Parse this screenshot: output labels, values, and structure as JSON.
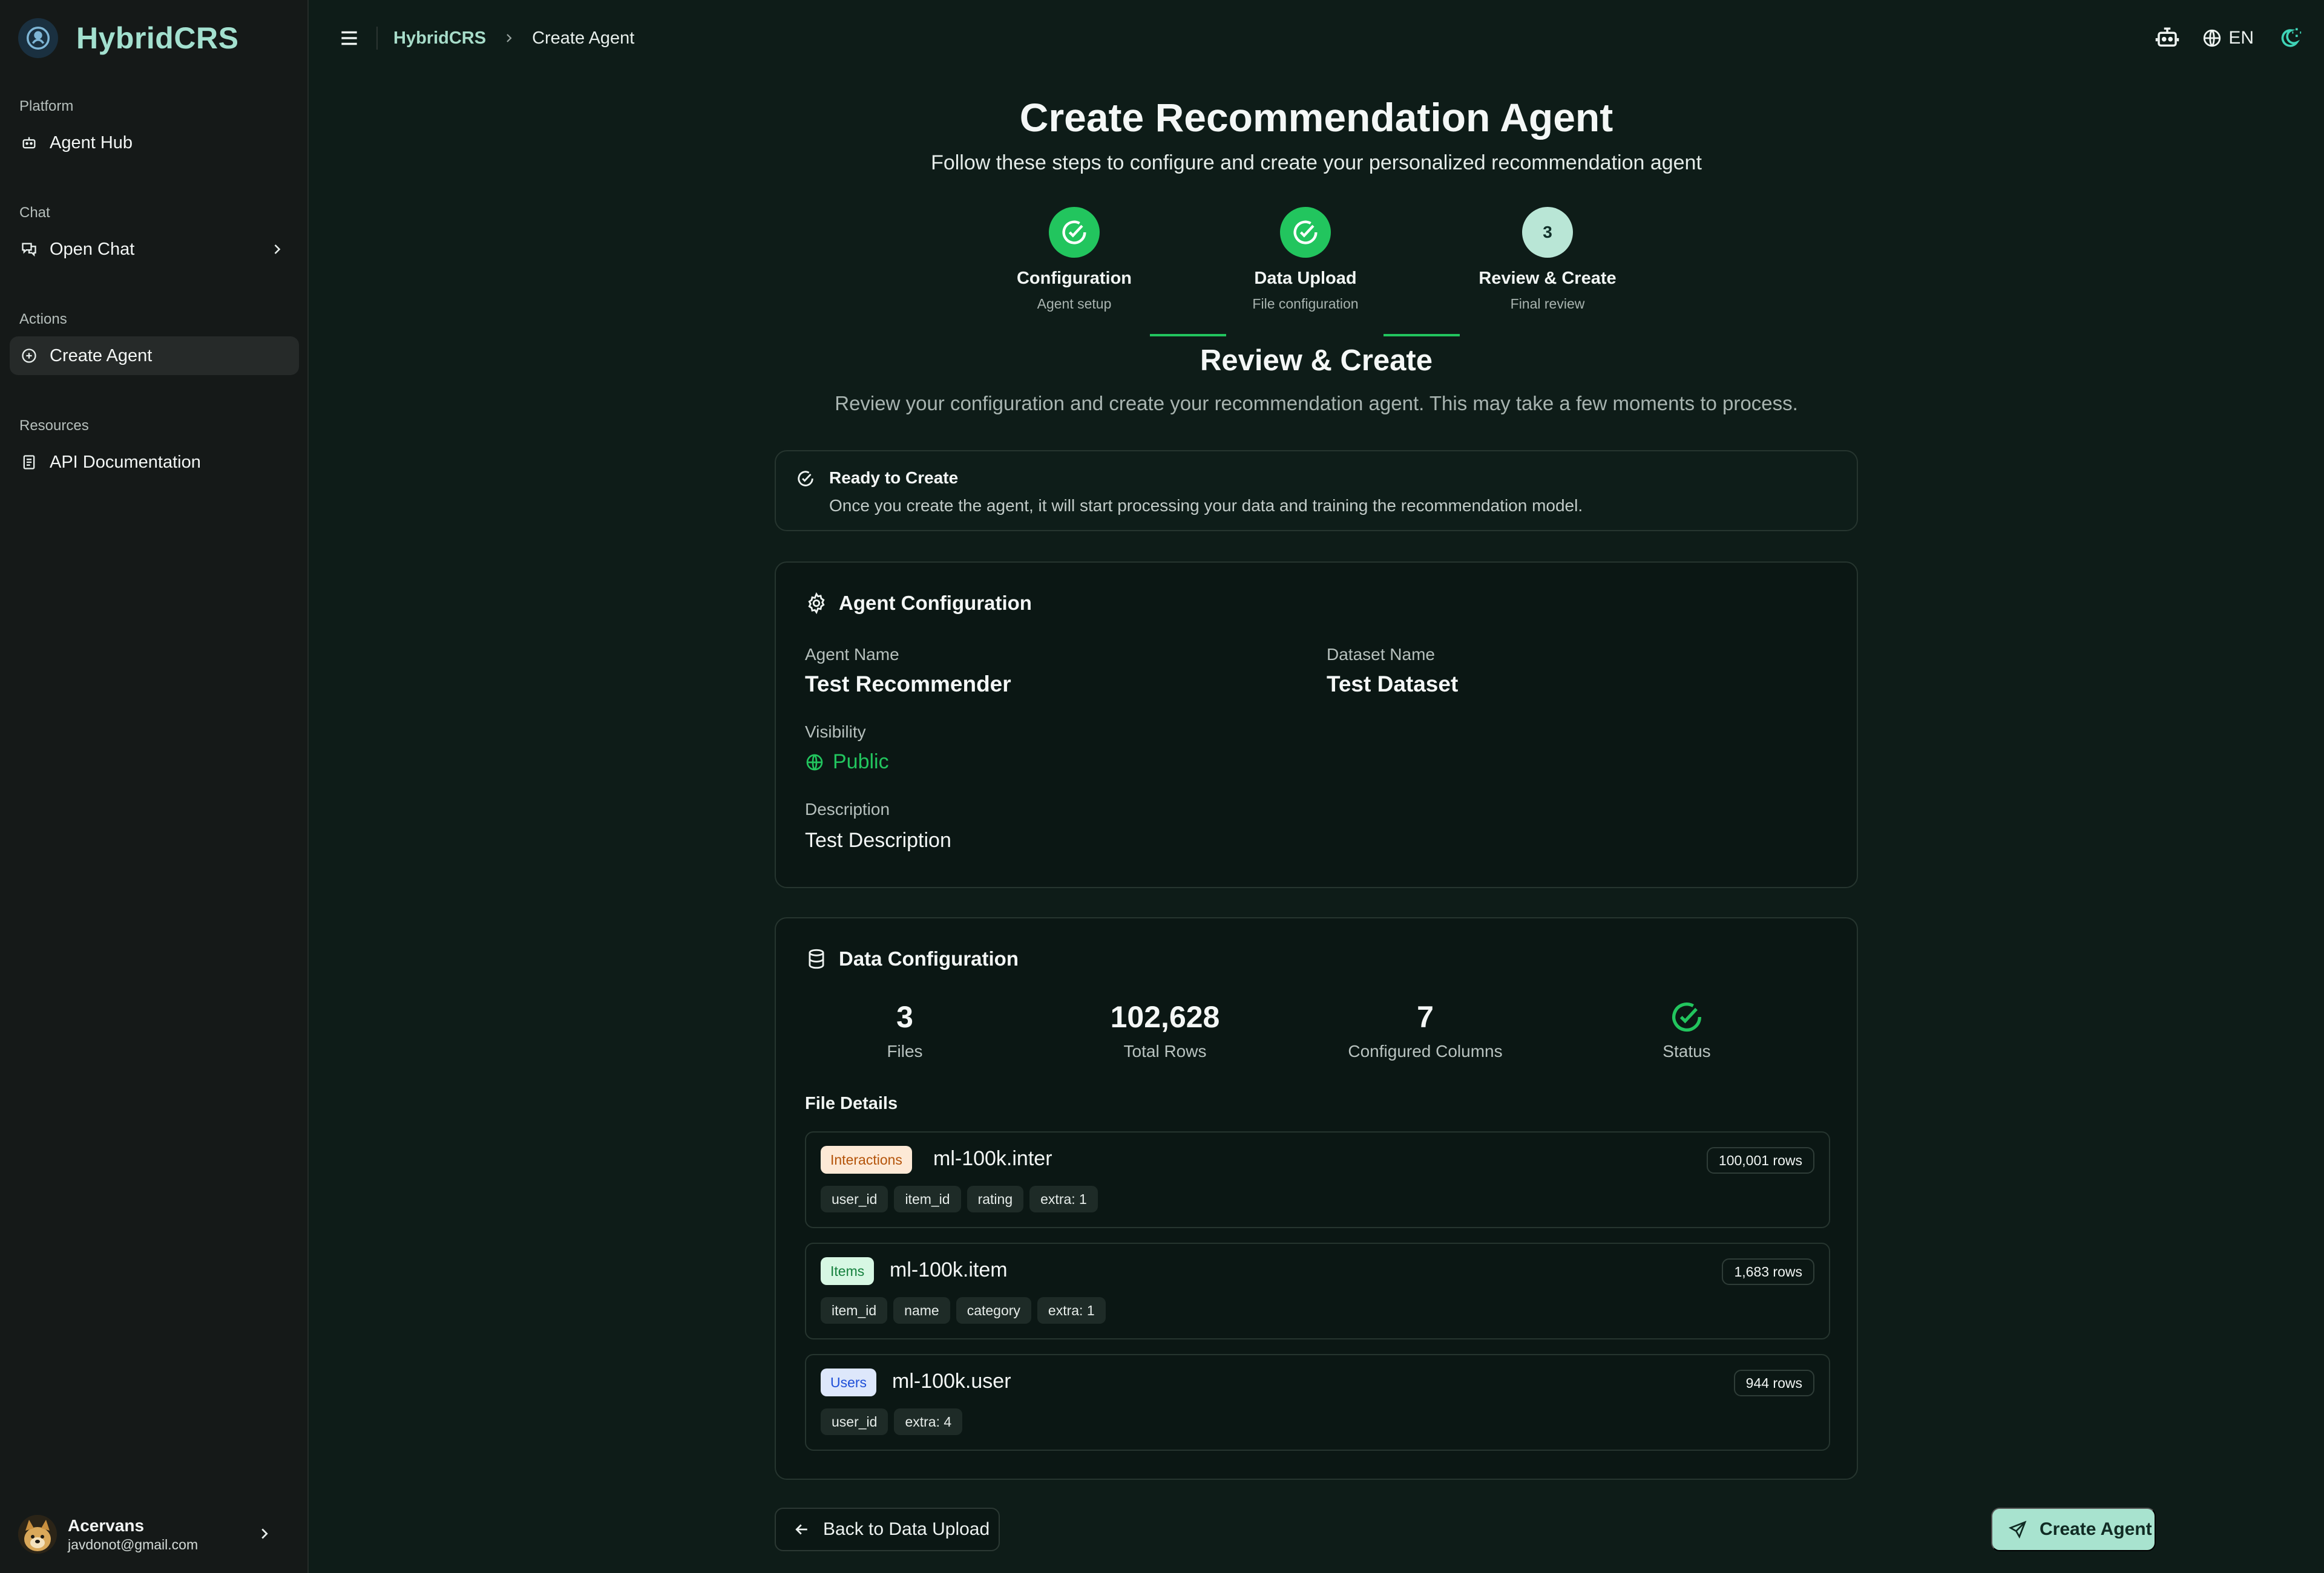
{
  "app": {
    "name": "HybridCRS"
  },
  "sidebar": {
    "sections": [
      {
        "label": "Platform",
        "items": [
          {
            "label": "Agent Hub",
            "icon": "robot-icon"
          }
        ]
      },
      {
        "label": "Chat",
        "items": [
          {
            "label": "Open Chat",
            "icon": "chat-icon"
          }
        ]
      },
      {
        "label": "Actions",
        "items": [
          {
            "label": "Create Agent",
            "icon": "plus-circle-icon",
            "active": true
          }
        ]
      },
      {
        "label": "Resources",
        "items": [
          {
            "label": "API Documentation",
            "icon": "document-icon"
          }
        ]
      }
    ],
    "user": {
      "name": "Acervans",
      "email": "javdonot@gmail.com"
    }
  },
  "topbar": {
    "breadcrumb": [
      "HybridCRS",
      "Create Agent"
    ],
    "language": "EN"
  },
  "page": {
    "title": "Create Recommendation Agent",
    "subtitle": "Follow these steps to configure and create your personalized recommendation agent"
  },
  "steps": [
    {
      "title": "Configuration",
      "sub": "Agent setup",
      "state": "done"
    },
    {
      "title": "Data Upload",
      "sub": "File configuration",
      "state": "done"
    },
    {
      "title": "Review & Create",
      "sub": "Final review",
      "state": "current",
      "number": "3"
    }
  ],
  "review": {
    "title": "Review & Create",
    "subtitle": "Review your configuration and create your recommendation agent. This may take a few moments to process."
  },
  "notice": {
    "title": "Ready to Create",
    "text": "Once you create the agent, it will start processing your data and training the recommendation model."
  },
  "agent_config": {
    "heading": "Agent Configuration",
    "agent_name_label": "Agent Name",
    "agent_name": "Test Recommender",
    "dataset_name_label": "Dataset Name",
    "dataset_name": "Test Dataset",
    "visibility_label": "Visibility",
    "visibility": "Public",
    "description_label": "Description",
    "description": "Test Description"
  },
  "data_config": {
    "heading": "Data Configuration",
    "stats": {
      "files": "3",
      "files_label": "Files",
      "total_rows": "102,628",
      "total_rows_label": "Total Rows",
      "columns": "7",
      "columns_label": "Configured Columns",
      "status_label": "Status"
    },
    "file_details_label": "File Details",
    "files": [
      {
        "tag": "Interactions",
        "name": "ml-100k.inter",
        "rows": "100,001 rows",
        "columns": [
          "user_id",
          "item_id",
          "rating",
          "extra: 1"
        ]
      },
      {
        "tag": "Items",
        "name": "ml-100k.item",
        "rows": "1,683 rows",
        "columns": [
          "item_id",
          "name",
          "category",
          "extra: 1"
        ]
      },
      {
        "tag": "Users",
        "name": "ml-100k.user",
        "rows": "944 rows",
        "columns": [
          "user_id",
          "extra: 4"
        ]
      }
    ]
  },
  "actions": {
    "back": "Back to Data Upload",
    "create": "Create Agent"
  },
  "colors": {
    "accent": "#22c55e",
    "brand": "#a3e0cf",
    "background": "#0e1c18",
    "sidebar": "#151918"
  }
}
